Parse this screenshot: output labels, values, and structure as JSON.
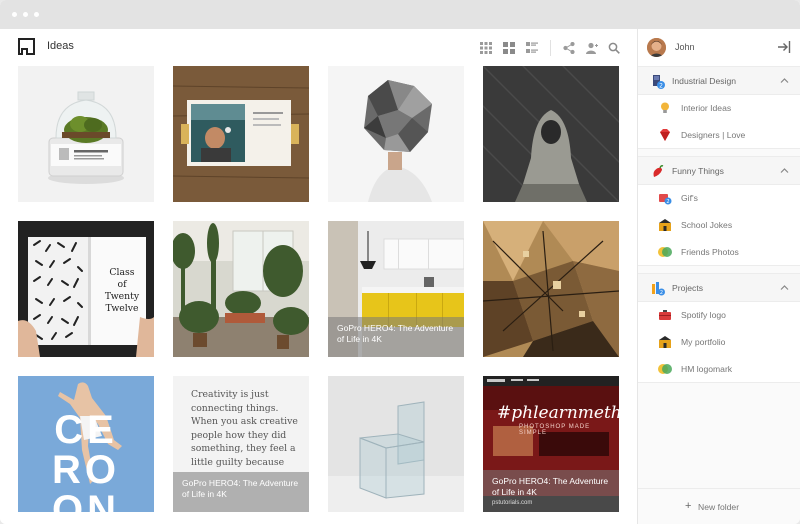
{
  "header": {
    "title": "Ideas"
  },
  "icons": {
    "header": [
      "grid-small-icon",
      "grid-large-icon",
      "list-view-icon",
      "share-icon",
      "add-user-icon",
      "search-icon"
    ]
  },
  "tiles": [
    {
      "name": "terrarium-jar",
      "colors": [
        "#f2f2f2",
        "#5a7a25"
      ]
    },
    {
      "name": "magazine-man-flower",
      "colors": [
        "#7a5a3a",
        "#2f5b5f"
      ]
    },
    {
      "name": "low-poly-mask",
      "colors": [
        "#f5f5f5",
        "#555555"
      ]
    },
    {
      "name": "hooded-figure",
      "colors": [
        "#3a3a3a",
        "#555555"
      ]
    },
    {
      "name": "patterned-book",
      "colors": [
        "#222222",
        "#eeeeee"
      ],
      "text": [
        "Class",
        "of",
        "Twenty",
        "Twelve"
      ]
    },
    {
      "name": "plant-interior",
      "colors": [
        "#d8d8cf",
        "#3f5a2e"
      ]
    },
    {
      "name": "kitchen",
      "colors": [
        "#ececec",
        "#e7c51a"
      ],
      "caption": [
        "GoPro HERO4: The Adventure",
        "of Life in 4K"
      ]
    },
    {
      "name": "abstract-architecture",
      "colors": [
        "#b08a55",
        "#3a2a1a"
      ]
    },
    {
      "name": "dancer-poster",
      "colors": [
        "#7aa9d9",
        "#ffffff"
      ],
      "text": [
        "CE",
        "RO",
        "ON"
      ]
    },
    {
      "name": "quote-card",
      "colors": [
        "#f3f3f3",
        "#555555"
      ],
      "quote": [
        "Creativity is just",
        "connecting things.",
        "When you ask creative",
        "people how they did",
        "something, they feel a",
        "little guilty because"
      ],
      "caption": [
        "GoPro HERO4: The Adventure",
        "of Life in 4K"
      ]
    },
    {
      "name": "glass-chair",
      "colors": [
        "#e4e4e4",
        "#9ab"
      ]
    },
    {
      "name": "website-screenshot",
      "colors": [
        "#7a1818",
        "#ffffff"
      ],
      "text": [
        "#phlearnmethod",
        "PHOTOSHOP MADE SIMPLE"
      ],
      "caption": [
        "GoPro HERO4: The Adventure",
        "of Life in 4K",
        "pstutorials.com"
      ]
    }
  ],
  "sidebar": {
    "user": {
      "name": "John"
    },
    "sections": [
      {
        "label": "Industrial Design",
        "items": [
          {
            "label": "Interior Ideas"
          },
          {
            "label": "Designers | Love"
          }
        ]
      },
      {
        "label": "Funny Things",
        "items": [
          {
            "label": "Gif's"
          },
          {
            "label": "School Jokes"
          },
          {
            "label": "Friends Photos"
          }
        ]
      },
      {
        "label": "Projects",
        "items": [
          {
            "label": "Spotify logo"
          },
          {
            "label": "My portfolio"
          },
          {
            "label": "HM logomark"
          }
        ]
      }
    ],
    "new_folder": {
      "plus": "+",
      "label": "New folder"
    }
  }
}
